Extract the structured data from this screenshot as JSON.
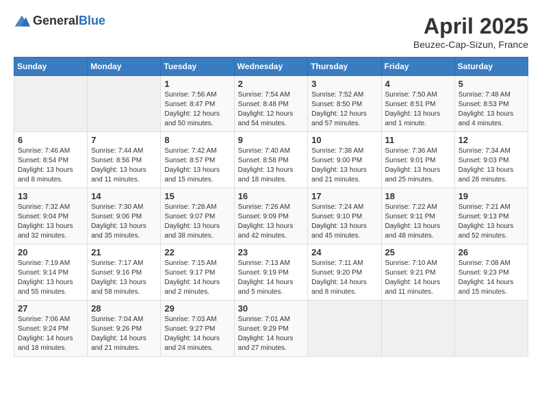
{
  "header": {
    "logo_general": "General",
    "logo_blue": "Blue",
    "month_title": "April 2025",
    "location": "Beuzec-Cap-Sizun, France"
  },
  "weekdays": [
    "Sunday",
    "Monday",
    "Tuesday",
    "Wednesday",
    "Thursday",
    "Friday",
    "Saturday"
  ],
  "weeks": [
    [
      {
        "day": "",
        "info": ""
      },
      {
        "day": "",
        "info": ""
      },
      {
        "day": "1",
        "info": "Sunrise: 7:56 AM\nSunset: 8:47 PM\nDaylight: 12 hours and 50 minutes."
      },
      {
        "day": "2",
        "info": "Sunrise: 7:54 AM\nSunset: 8:48 PM\nDaylight: 12 hours and 54 minutes."
      },
      {
        "day": "3",
        "info": "Sunrise: 7:52 AM\nSunset: 8:50 PM\nDaylight: 12 hours and 57 minutes."
      },
      {
        "day": "4",
        "info": "Sunrise: 7:50 AM\nSunset: 8:51 PM\nDaylight: 13 hours and 1 minute."
      },
      {
        "day": "5",
        "info": "Sunrise: 7:48 AM\nSunset: 8:53 PM\nDaylight: 13 hours and 4 minutes."
      }
    ],
    [
      {
        "day": "6",
        "info": "Sunrise: 7:46 AM\nSunset: 8:54 PM\nDaylight: 13 hours and 8 minutes."
      },
      {
        "day": "7",
        "info": "Sunrise: 7:44 AM\nSunset: 8:56 PM\nDaylight: 13 hours and 11 minutes."
      },
      {
        "day": "8",
        "info": "Sunrise: 7:42 AM\nSunset: 8:57 PM\nDaylight: 13 hours and 15 minutes."
      },
      {
        "day": "9",
        "info": "Sunrise: 7:40 AM\nSunset: 8:58 PM\nDaylight: 13 hours and 18 minutes."
      },
      {
        "day": "10",
        "info": "Sunrise: 7:38 AM\nSunset: 9:00 PM\nDaylight: 13 hours and 21 minutes."
      },
      {
        "day": "11",
        "info": "Sunrise: 7:36 AM\nSunset: 9:01 PM\nDaylight: 13 hours and 25 minutes."
      },
      {
        "day": "12",
        "info": "Sunrise: 7:34 AM\nSunset: 9:03 PM\nDaylight: 13 hours and 28 minutes."
      }
    ],
    [
      {
        "day": "13",
        "info": "Sunrise: 7:32 AM\nSunset: 9:04 PM\nDaylight: 13 hours and 32 minutes."
      },
      {
        "day": "14",
        "info": "Sunrise: 7:30 AM\nSunset: 9:06 PM\nDaylight: 13 hours and 35 minutes."
      },
      {
        "day": "15",
        "info": "Sunrise: 7:28 AM\nSunset: 9:07 PM\nDaylight: 13 hours and 38 minutes."
      },
      {
        "day": "16",
        "info": "Sunrise: 7:26 AM\nSunset: 9:09 PM\nDaylight: 13 hours and 42 minutes."
      },
      {
        "day": "17",
        "info": "Sunrise: 7:24 AM\nSunset: 9:10 PM\nDaylight: 13 hours and 45 minutes."
      },
      {
        "day": "18",
        "info": "Sunrise: 7:22 AM\nSunset: 9:11 PM\nDaylight: 13 hours and 48 minutes."
      },
      {
        "day": "19",
        "info": "Sunrise: 7:21 AM\nSunset: 9:13 PM\nDaylight: 13 hours and 52 minutes."
      }
    ],
    [
      {
        "day": "20",
        "info": "Sunrise: 7:19 AM\nSunset: 9:14 PM\nDaylight: 13 hours and 55 minutes."
      },
      {
        "day": "21",
        "info": "Sunrise: 7:17 AM\nSunset: 9:16 PM\nDaylight: 13 hours and 58 minutes."
      },
      {
        "day": "22",
        "info": "Sunrise: 7:15 AM\nSunset: 9:17 PM\nDaylight: 14 hours and 2 minutes."
      },
      {
        "day": "23",
        "info": "Sunrise: 7:13 AM\nSunset: 9:19 PM\nDaylight: 14 hours and 5 minutes."
      },
      {
        "day": "24",
        "info": "Sunrise: 7:11 AM\nSunset: 9:20 PM\nDaylight: 14 hours and 8 minutes."
      },
      {
        "day": "25",
        "info": "Sunrise: 7:10 AM\nSunset: 9:21 PM\nDaylight: 14 hours and 11 minutes."
      },
      {
        "day": "26",
        "info": "Sunrise: 7:08 AM\nSunset: 9:23 PM\nDaylight: 14 hours and 15 minutes."
      }
    ],
    [
      {
        "day": "27",
        "info": "Sunrise: 7:06 AM\nSunset: 9:24 PM\nDaylight: 14 hours and 18 minutes."
      },
      {
        "day": "28",
        "info": "Sunrise: 7:04 AM\nSunset: 9:26 PM\nDaylight: 14 hours and 21 minutes."
      },
      {
        "day": "29",
        "info": "Sunrise: 7:03 AM\nSunset: 9:27 PM\nDaylight: 14 hours and 24 minutes."
      },
      {
        "day": "30",
        "info": "Sunrise: 7:01 AM\nSunset: 9:29 PM\nDaylight: 14 hours and 27 minutes."
      },
      {
        "day": "",
        "info": ""
      },
      {
        "day": "",
        "info": ""
      },
      {
        "day": "",
        "info": ""
      }
    ]
  ]
}
